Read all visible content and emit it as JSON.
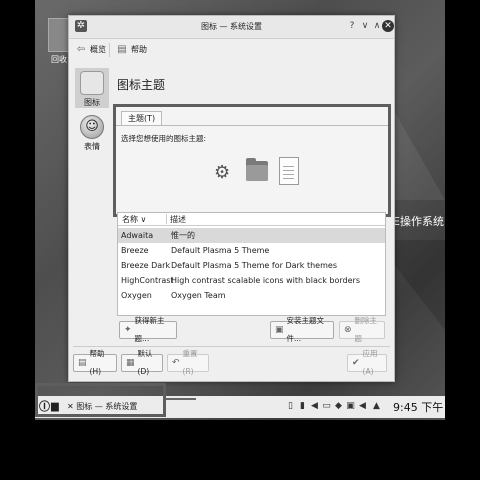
{
  "desktop": {
    "icon_label": "回收",
    "overlay_text": "E操作系统"
  },
  "window": {
    "title": "图标 — 系统设置",
    "titlebar_buttons": [
      "?",
      "∨",
      "∧",
      "✕"
    ]
  },
  "toolbar": {
    "overview_label": "概览",
    "help_label": "帮助"
  },
  "sidebar": {
    "items": [
      {
        "label": "图标",
        "icon": "icons-icon",
        "active": true
      },
      {
        "label": "表情",
        "icon": "emoticon-icon",
        "active": false
      }
    ]
  },
  "page": {
    "title": "图标主题"
  },
  "tab": {
    "label": "主题(T)",
    "prompt": "选择您想使用的图标主题:"
  },
  "preview_icons": [
    "gear-preview-icon",
    "folder-preview-icon",
    "document-preview-icon"
  ],
  "table": {
    "columns": [
      "名称",
      "描述"
    ],
    "rows": [
      {
        "name": "Adwaita",
        "description": "惟一的",
        "selected": true
      },
      {
        "name": "Breeze",
        "description": "Default Plasma 5 Theme",
        "selected": false
      },
      {
        "name": "Breeze Dark",
        "description": "Default Plasma 5 Theme for Dark themes",
        "selected": false
      },
      {
        "name": "HighContrast",
        "description": "High contrast scalable icons with black borders",
        "selected": false
      },
      {
        "name": "Oxygen",
        "description": "Oxygen Team",
        "selected": false
      }
    ]
  },
  "actions": {
    "get_new": "获得新主题...",
    "install_file": "安装主题文件...",
    "remove": "删除主题"
  },
  "footer": {
    "help": "帮助(H)",
    "defaults": "默认(D)",
    "reset": "重置(R)",
    "apply": "应用(A)"
  },
  "taskbar": {
    "task_label": "图标 — 系统设置",
    "clock": "9:45 下午"
  },
  "colors": {
    "highlight_border": "#5e5e5e",
    "selected_row": "#d9d9d9"
  }
}
